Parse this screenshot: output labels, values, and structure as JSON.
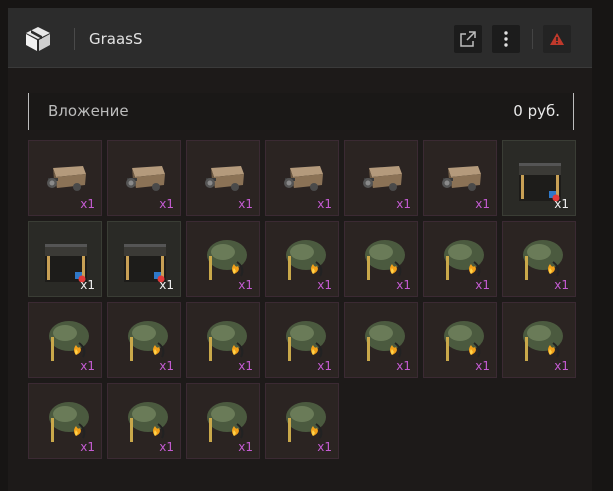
{
  "header": {
    "title": "GraasS",
    "icons": {
      "logo": "box-logo-icon",
      "external": "external-link-icon",
      "more": "more-vertical-icon",
      "report": "warning-icon"
    },
    "colors": {
      "report_icon": "#c0392b"
    }
  },
  "investment": {
    "label": "Вложение",
    "value": "0 руб."
  },
  "items": [
    {
      "kind": "cart",
      "qty": "x1"
    },
    {
      "kind": "cart",
      "qty": "x1"
    },
    {
      "kind": "cart",
      "qty": "x1"
    },
    {
      "kind": "cart",
      "qty": "x1"
    },
    {
      "kind": "cart",
      "qty": "x1"
    },
    {
      "kind": "cart",
      "qty": "x1"
    },
    {
      "kind": "chest",
      "qty": "x1"
    },
    {
      "kind": "chest",
      "qty": "x1"
    },
    {
      "kind": "chest",
      "qty": "x1"
    },
    {
      "kind": "torch",
      "qty": "x1"
    },
    {
      "kind": "torch",
      "qty": "x1"
    },
    {
      "kind": "torch",
      "qty": "x1"
    },
    {
      "kind": "torch",
      "qty": "x1"
    },
    {
      "kind": "torch",
      "qty": "x1"
    },
    {
      "kind": "torch",
      "qty": "x1"
    },
    {
      "kind": "torch",
      "qty": "x1"
    },
    {
      "kind": "torch",
      "qty": "x1"
    },
    {
      "kind": "torch",
      "qty": "x1"
    },
    {
      "kind": "torch",
      "qty": "x1"
    },
    {
      "kind": "torch",
      "qty": "x1"
    },
    {
      "kind": "torch",
      "qty": "x1"
    },
    {
      "kind": "torch",
      "qty": "x1"
    },
    {
      "kind": "torch",
      "qty": "x1"
    },
    {
      "kind": "torch",
      "qty": "x1"
    },
    {
      "kind": "torch",
      "qty": "x1"
    }
  ]
}
